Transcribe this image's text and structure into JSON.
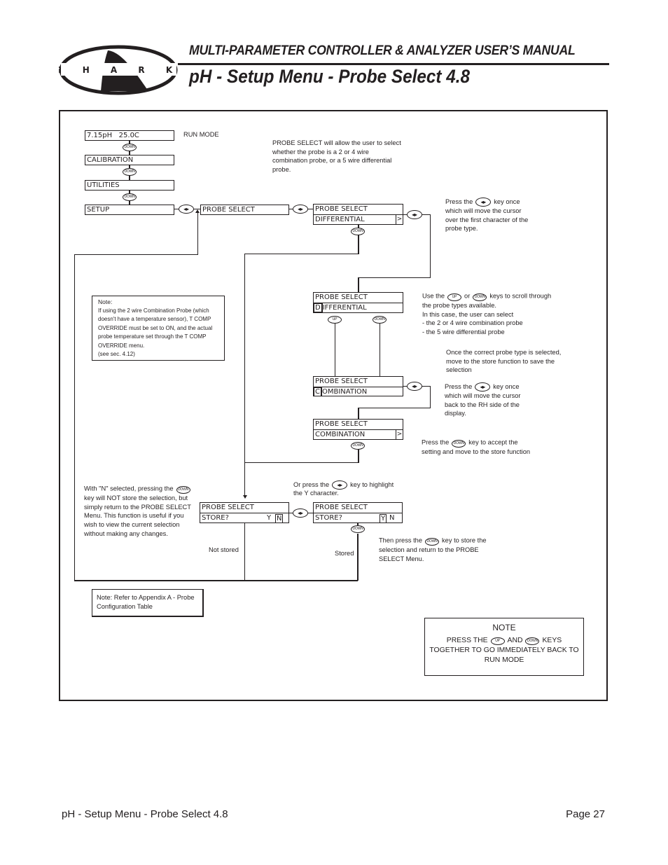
{
  "header": {
    "logo_text": "S H A R K",
    "manual_title": "MULTI-PARAMETER CONTROLLER & ANALYZER USER’S MANUAL",
    "page_title": "pH - Setup Menu - Probe Select 4.8"
  },
  "keys": {
    "down": "DOWN",
    "up": "UP",
    "left_right": "◂▸"
  },
  "menu": {
    "run_display": "7.15pH   25.0C",
    "run_mode_label": "RUN MODE",
    "calibration": "CALIBRATION",
    "utilities": "UTILITIES",
    "setup": "SETUP",
    "probe_select": "PROBE SELECT"
  },
  "screens": {
    "s1": {
      "line1": "PROBE SELECT",
      "line2": "DIFFERENTIAL",
      "indicator": ">"
    },
    "s2": {
      "line1": "PROBE SELECT",
      "cursor_char": "D",
      "line2_rest": "IFFERENTIAL"
    },
    "s3": {
      "line1": "PROBE SELECT",
      "cursor_char": "C",
      "line2_rest": "OMBINATION"
    },
    "s4": {
      "line1": "PROBE SELECT",
      "line2": "COMBINATION",
      "indicator": ">"
    },
    "store_n": {
      "line1": "PROBE SELECT",
      "line2": "STORE?",
      "y": "Y",
      "n": "N",
      "selected": "N"
    },
    "store_y": {
      "line1": "PROBE SELECT",
      "line2": "STORE?",
      "y": "Y",
      "n": "N",
      "selected": "Y"
    }
  },
  "annotations": {
    "intro": [
      "PROBE SELECT will allow the user to select",
      "whether the probe is a 2 or 4 wire",
      "combination probe, or a 5 wire differential",
      "probe."
    ],
    "press_lr_first": {
      "pre": "Press the",
      "post": "key once",
      "lines": [
        "which will move the cursor",
        "over the first character of the",
        "probe type."
      ]
    },
    "use_up_down": {
      "pre": "Use the",
      "mid": "or",
      "post": "keys to scroll through",
      "lines": [
        "the probe types available.",
        "In this case, the user can select",
        "- the 2 or 4 wire combination probe",
        "- the 5 wire differential probe"
      ]
    },
    "once_correct": [
      "Once the correct probe type is selected,",
      "move to the store function to save the",
      "selection"
    ],
    "press_lr_back": {
      "pre": "Press the",
      "post": "key once",
      "lines": [
        "which will move the cursor",
        "back to the RH side of the",
        "display."
      ]
    },
    "press_down_accept": {
      "pre": "Press the",
      "post": "key to accept the",
      "lines": [
        "setting and move to the store function"
      ]
    },
    "with_n_selected": {
      "pre": "With \"N\" selected, pressing the",
      "lines": [
        "key will NOT store the selection, but",
        "simply return to the PROBE SELECT",
        "Menu. This function is useful if you",
        "wish to view the current selection",
        "without making any changes."
      ]
    },
    "or_press_lr": {
      "pre": "Or press the",
      "post": "key to highlight",
      "lines": [
        "the Y character."
      ]
    },
    "then_press_down": {
      "pre": "Then press the",
      "post": "key to store the",
      "lines": [
        "selection and return to the PROBE",
        "SELECT Menu."
      ]
    },
    "not_stored": "Not stored",
    "stored": "Stored"
  },
  "notes": {
    "tcomp": {
      "title": "Note:",
      "lines": [
        "If using the 2 wire Combination Probe (which",
        "doesn't have a temperature sensor), T COMP",
        "OVERRIDE must be set to ON, and the actual",
        "probe temperature set through the T COMP",
        "OVERRIDE menu.",
        "(see sec. 4.12)"
      ]
    },
    "appendix": [
      "Note: Refer to Appendix A - Probe",
      "Configuration Table"
    ],
    "quick_return": {
      "title": "NOTE",
      "pre": "PRESS THE",
      "mid": "AND",
      "post": "KEYS",
      "lines": [
        "TOGETHER TO GO IMMEDIATELY BACK TO",
        "RUN MODE"
      ]
    }
  },
  "footer": {
    "left": "pH - Setup Menu - Probe Select 4.8",
    "right": "Page 27"
  }
}
